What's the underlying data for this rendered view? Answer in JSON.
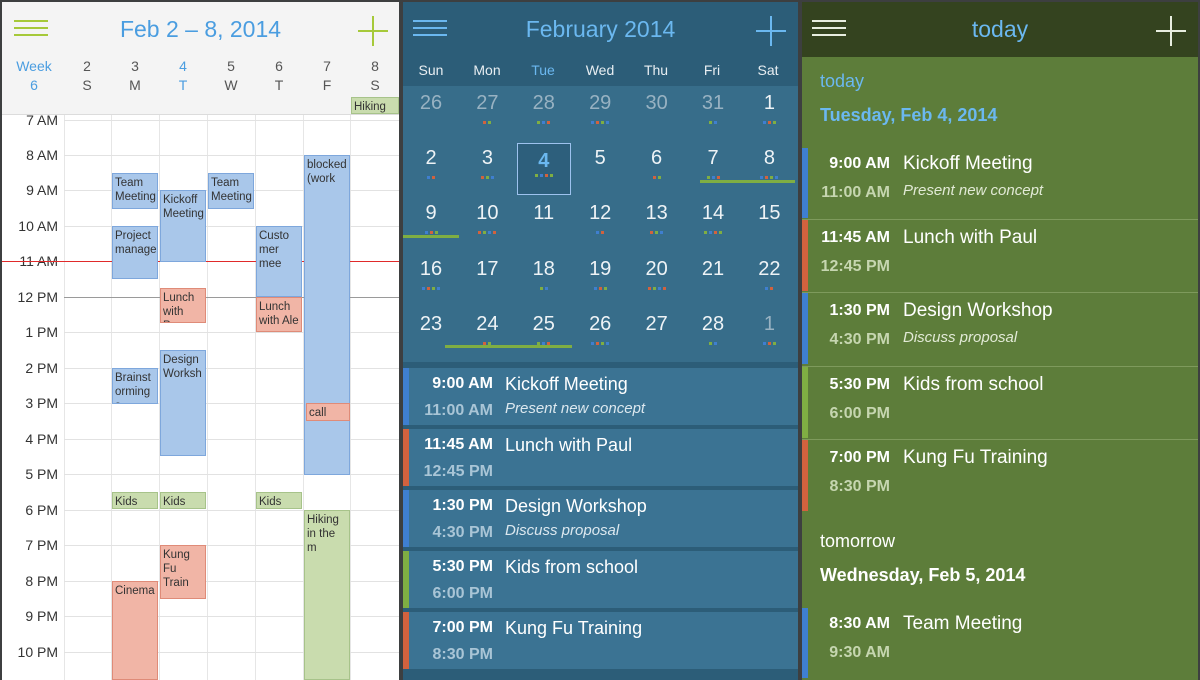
{
  "week_view": {
    "title": "Feb 2 – 8, 2014",
    "accent": "#4a9de0",
    "menu_icon": "hamburger-menu-icon",
    "add_icon": "plus-icon",
    "week_label": "Week",
    "week_number": "6",
    "days": [
      {
        "num": "2",
        "letter": "S"
      },
      {
        "num": "3",
        "letter": "M"
      },
      {
        "num": "4",
        "letter": "T"
      },
      {
        "num": "5",
        "letter": "W"
      },
      {
        "num": "6",
        "letter": "T"
      },
      {
        "num": "7",
        "letter": "F"
      },
      {
        "num": "8",
        "letter": "S"
      }
    ],
    "hours": [
      "7 AM",
      "8 AM",
      "9 AM",
      "10 AM",
      "11 AM",
      "12 PM",
      "1 PM",
      "2 PM",
      "3 PM",
      "4 PM",
      "5 PM",
      "6 PM",
      "7 PM",
      "8 PM",
      "9 PM",
      "10 PM"
    ],
    "events": [
      {
        "label": "Hiking in",
        "color": "green"
      },
      {
        "label": "Team Meeting",
        "color": "blue"
      },
      {
        "label": "Kickoff Meeting",
        "color": "blue"
      },
      {
        "label": "Team Meeting",
        "color": "blue"
      },
      {
        "label": "blocked (work",
        "color": "blue"
      },
      {
        "label": "Project manage",
        "color": "blue"
      },
      {
        "label": "Custo mer mee",
        "color": "blue"
      },
      {
        "label": "Lunch with Pau",
        "color": "red"
      },
      {
        "label": "Lunch with Ale",
        "color": "red"
      },
      {
        "label": "Design Worksh",
        "color": "blue"
      },
      {
        "label": "Brainst orming s",
        "color": "blue"
      },
      {
        "label": "call Joh",
        "color": "red"
      },
      {
        "label": "Kids fron",
        "color": "green"
      },
      {
        "label": "Kids fron",
        "color": "green"
      },
      {
        "label": "Kids fron",
        "color": "green"
      },
      {
        "label": "Hiking in the m",
        "color": "green"
      },
      {
        "label": "Kung Fu Train",
        "color": "red"
      },
      {
        "label": "Cinema",
        "color": "red"
      }
    ]
  },
  "month_view": {
    "title": "February 2014",
    "menu_icon": "hamburger-menu-icon",
    "add_icon": "plus-icon",
    "weekdays": [
      "Sun",
      "Mon",
      "Tue",
      "Wed",
      "Thu",
      "Fri",
      "Sat"
    ],
    "today_weekday": "Tue",
    "weeks": [
      [
        "26",
        "27",
        "28",
        "29",
        "30",
        "31",
        "1"
      ],
      [
        "2",
        "3",
        "4",
        "5",
        "6",
        "7",
        "8"
      ],
      [
        "9",
        "10",
        "11",
        "12",
        "13",
        "14",
        "15"
      ],
      [
        "16",
        "17",
        "18",
        "19",
        "20",
        "21",
        "22"
      ],
      [
        "23",
        "24",
        "25",
        "26",
        "27",
        "28",
        "1"
      ]
    ],
    "selected_day": "4",
    "events": [
      {
        "start": "9:00 AM",
        "end": "11:00 AM",
        "name": "Kickoff Meeting",
        "note": "Present new concept",
        "color": "#3f7fd0"
      },
      {
        "start": "11:45 AM",
        "end": "12:45 PM",
        "name": "Lunch with Paul",
        "note": "",
        "color": "#d2623e"
      },
      {
        "start": "1:30 PM",
        "end": "4:30 PM",
        "name": "Design Workshop",
        "note": "Discuss proposal",
        "color": "#3f7fd0"
      },
      {
        "start": "5:30 PM",
        "end": "6:00 PM",
        "name": "Kids from school",
        "note": "",
        "color": "#7fae43"
      },
      {
        "start": "7:00 PM",
        "end": "8:30 PM",
        "name": "Kung Fu Training",
        "note": "",
        "color": "#d2623e"
      }
    ]
  },
  "agenda_view": {
    "title": "today",
    "menu_icon": "hamburger-menu-icon",
    "add_icon": "plus-icon",
    "today_label": "today",
    "today_date": "Tuesday, Feb 4, 2014",
    "tomorrow_label": "tomorrow",
    "tomorrow_date": "Wednesday, Feb 5, 2014",
    "today_events": [
      {
        "start": "9:00 AM",
        "end": "11:00 AM",
        "name": "Kickoff Meeting",
        "note": "Present new concept",
        "color": "#3f7fd0"
      },
      {
        "start": "11:45 AM",
        "end": "12:45 PM",
        "name": "Lunch with Paul",
        "note": "",
        "color": "#d2623e"
      },
      {
        "start": "1:30 PM",
        "end": "4:30 PM",
        "name": "Design Workshop",
        "note": "Discuss proposal",
        "color": "#3f7fd0"
      },
      {
        "start": "5:30 PM",
        "end": "6:00 PM",
        "name": "Kids from school",
        "note": "",
        "color": "#7fae43"
      },
      {
        "start": "7:00 PM",
        "end": "8:30 PM",
        "name": "Kung Fu Training",
        "note": "",
        "color": "#d2623e"
      }
    ],
    "tomorrow_events": [
      {
        "start": "8:30 AM",
        "end": "9:30 AM",
        "name": "Team Meeting",
        "note": "",
        "color": "#3f7fd0"
      }
    ]
  }
}
